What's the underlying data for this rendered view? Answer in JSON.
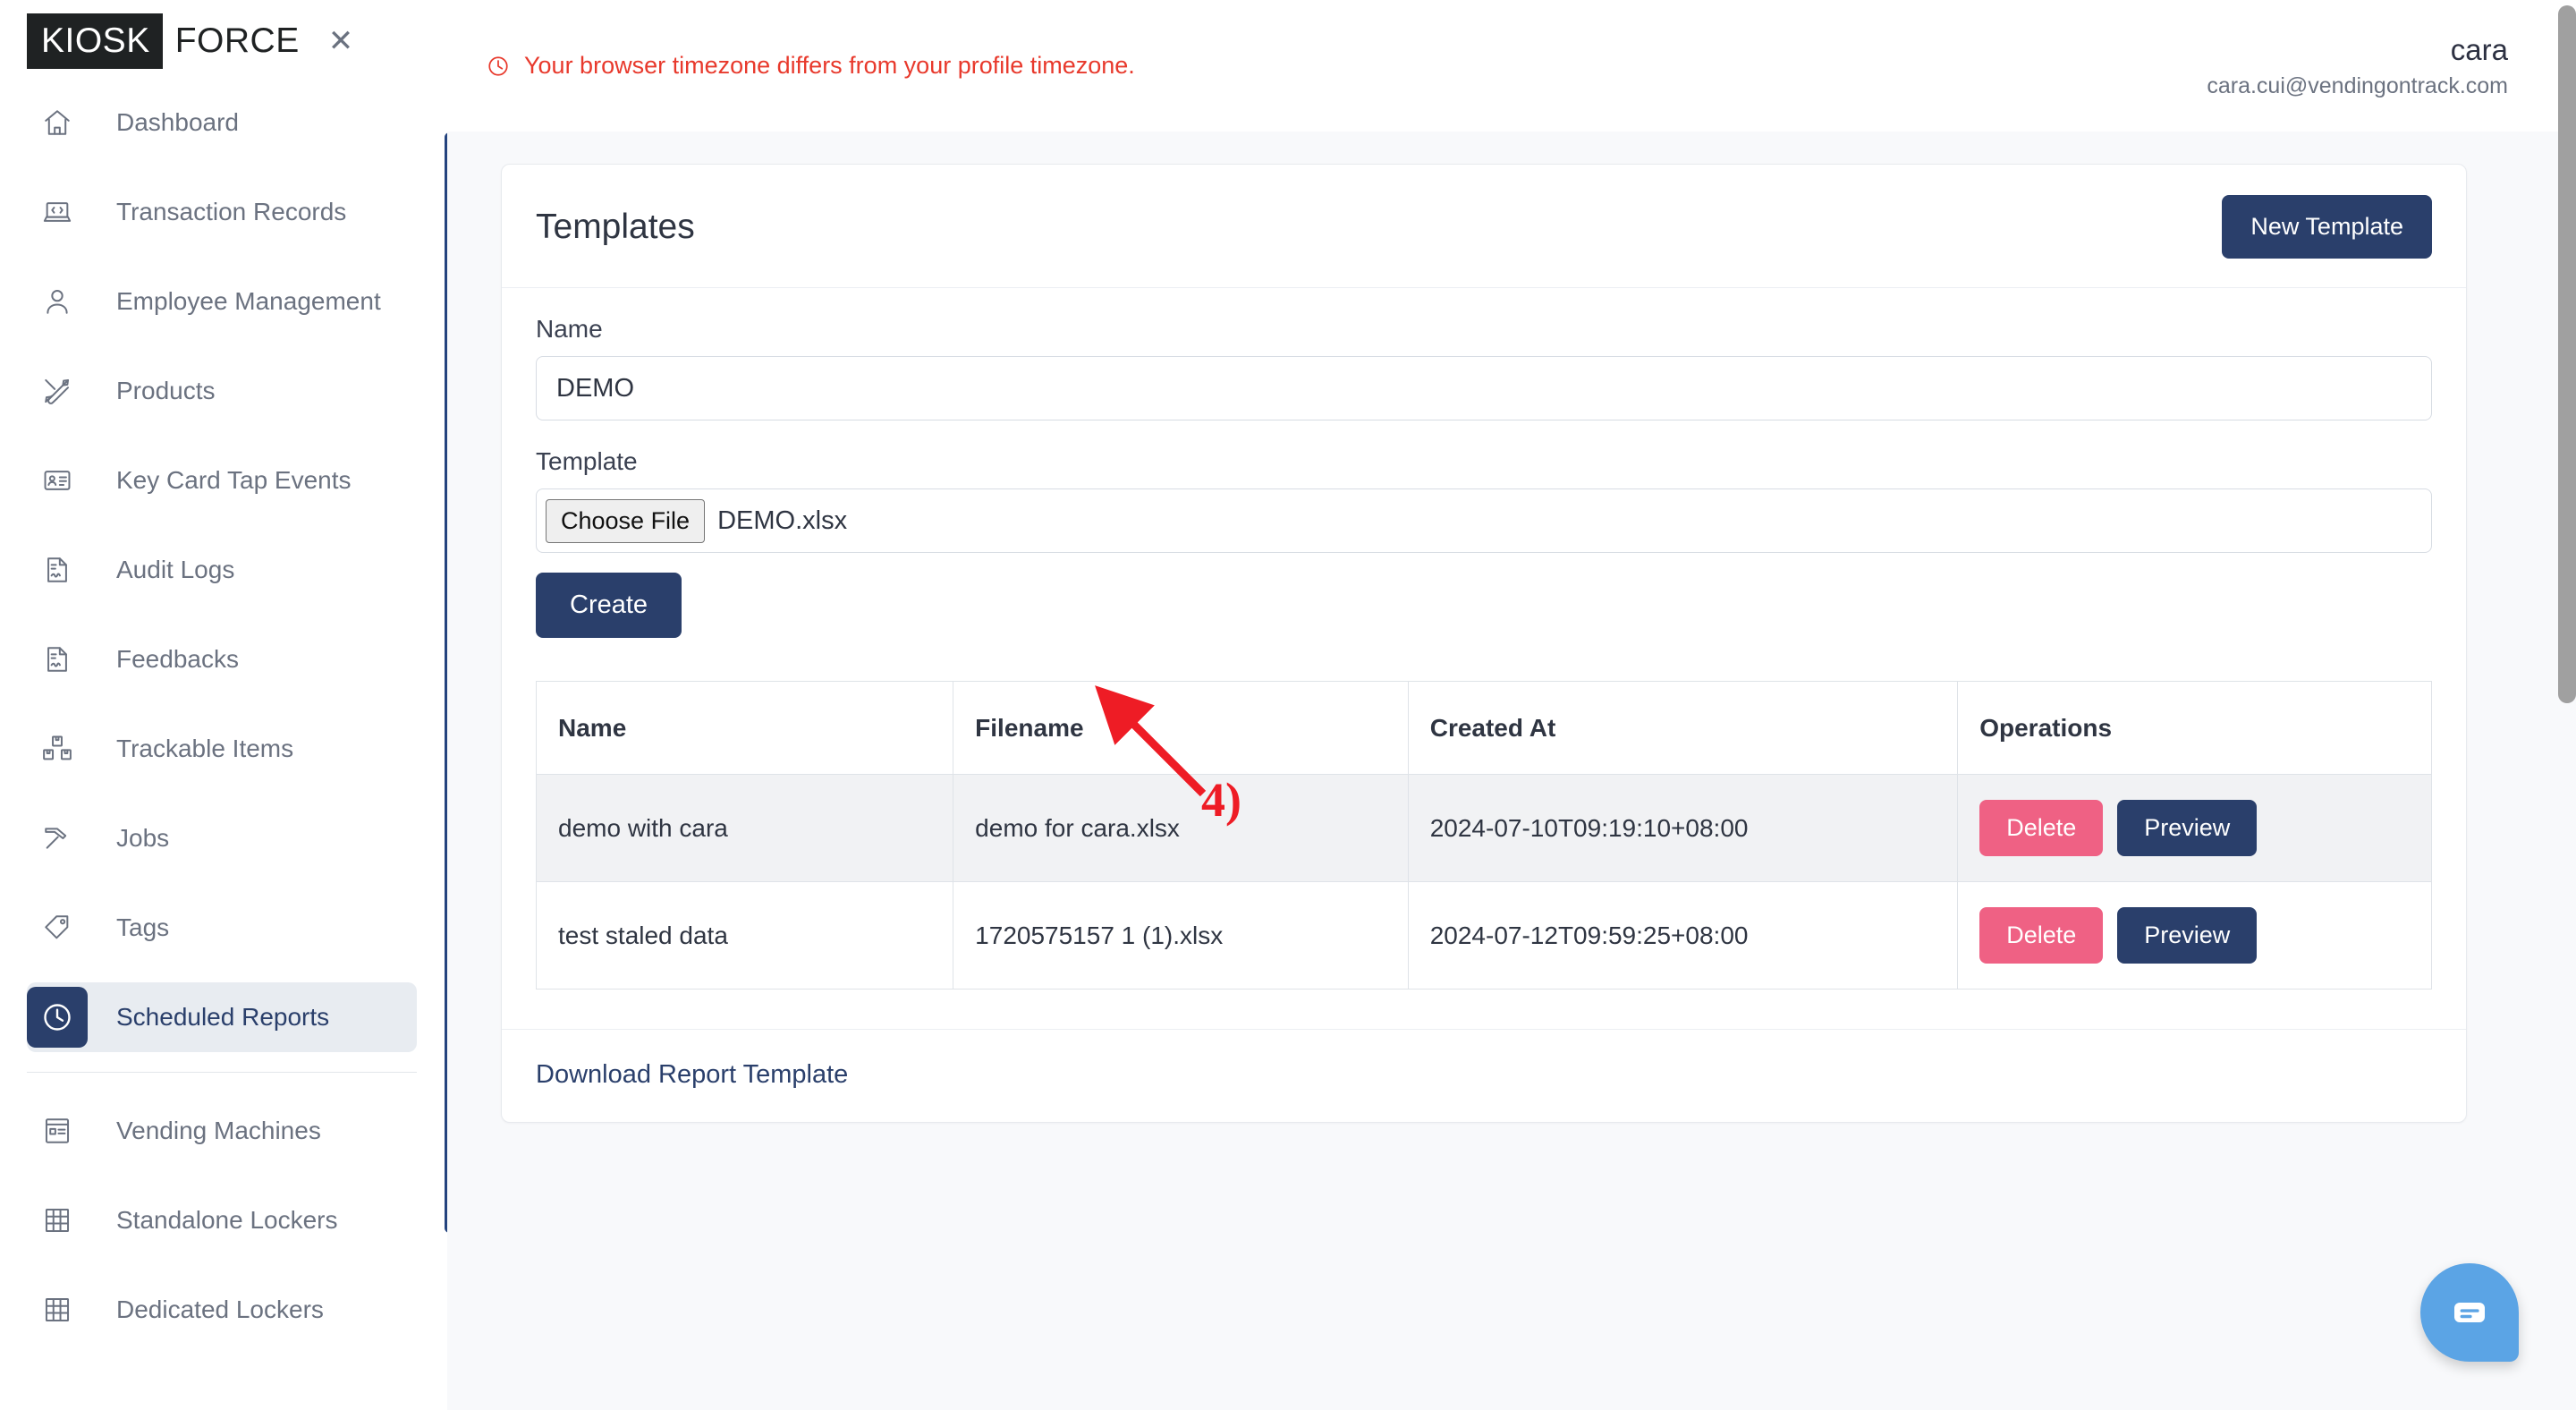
{
  "brand": {
    "mark": "KIOSK",
    "word": "FORCE",
    "close_icon": "close-icon"
  },
  "sidebar": {
    "items": [
      {
        "label": "Dashboard",
        "icon": "home-icon"
      },
      {
        "label": "Transaction Records",
        "icon": "laptop-code-icon"
      },
      {
        "label": "Employee Management",
        "icon": "user-icon"
      },
      {
        "label": "Products",
        "icon": "tools-icon"
      },
      {
        "label": "Key Card Tap Events",
        "icon": "id-card-icon"
      },
      {
        "label": "Audit Logs",
        "icon": "file-signature-icon"
      },
      {
        "label": "Feedbacks",
        "icon": "file-signature-icon"
      },
      {
        "label": "Trackable Items",
        "icon": "boxes-icon"
      },
      {
        "label": "Jobs",
        "icon": "hammer-icon"
      },
      {
        "label": "Tags",
        "icon": "tag-icon"
      },
      {
        "label": "Scheduled Reports",
        "icon": "clock-icon",
        "active": true
      }
    ],
    "items_below": [
      {
        "label": "Vending Machines",
        "icon": "vending-machine-icon"
      },
      {
        "label": "Standalone Lockers",
        "icon": "grid-icon"
      },
      {
        "label": "Dedicated Lockers",
        "icon": "grid-icon"
      }
    ]
  },
  "topbar": {
    "timezone_warning": "Your browser timezone differs from your profile timezone.",
    "warning_icon": "clock-icon",
    "warning_color": "#e8392c",
    "user_name": "cara",
    "user_email": "cara.cui@vendingontrack.com"
  },
  "card": {
    "title": "Templates",
    "new_template_label": "New Template",
    "form": {
      "name_label": "Name",
      "name_value": "DEMO",
      "name_placeholder": "",
      "template_label": "Template",
      "choose_file_label": "Choose File",
      "file_name": "DEMO.xlsx",
      "create_label": "Create"
    },
    "table": {
      "headers": [
        "Name",
        "Filename",
        "Created At",
        "Operations"
      ],
      "rows": [
        {
          "name": "demo with cara",
          "filename": "demo for cara.xlsx",
          "created_at": "2024-07-10T09:19:10+08:00",
          "delete_label": "Delete",
          "preview_label": "Preview"
        },
        {
          "name": "test staled data",
          "filename": "1720575157 1 (1).xlsx",
          "created_at": "2024-07-12T09:59:25+08:00",
          "delete_label": "Delete",
          "preview_label": "Preview"
        }
      ]
    },
    "download_link": "Download Report Template"
  },
  "annotation": {
    "step_label": "4)",
    "color": "#ee1c25"
  },
  "chat": {
    "icon": "chat-bubble-icon",
    "color": "#5ba4e5"
  },
  "colors": {
    "navy": "#2a3f6b",
    "pink": "#ef6184",
    "active_bg": "#e8ecf1",
    "page_bg": "#f8f9fb",
    "warning_red": "#e8392c"
  }
}
